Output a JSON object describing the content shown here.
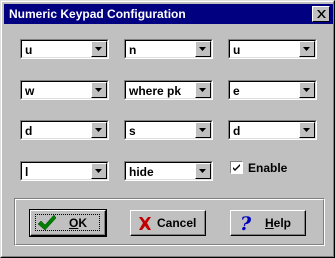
{
  "window": {
    "title": "Numeric Keypad Configuration",
    "close_icon": "close-icon"
  },
  "keys": [
    {
      "value": "u"
    },
    {
      "value": "n"
    },
    {
      "value": "u"
    },
    {
      "value": "w"
    },
    {
      "value": "where pk"
    },
    {
      "value": "e"
    },
    {
      "value": "d"
    },
    {
      "value": "s"
    },
    {
      "value": "d"
    },
    {
      "value": "l"
    },
    {
      "value": "hide"
    }
  ],
  "enable": {
    "label": "Enable",
    "checked": true
  },
  "buttons": {
    "ok": {
      "label_pre": "",
      "label_u": "O",
      "label_post": "K",
      "icon": "checkmark-icon",
      "icon_color": "#008000"
    },
    "cancel": {
      "label": "Cancel",
      "icon": "x-icon",
      "icon_color": "#c00000"
    },
    "help": {
      "label_pre": "",
      "label_u": "H",
      "label_post": "elp",
      "icon": "question-mark-icon",
      "icon_color": "#0000c0"
    }
  }
}
